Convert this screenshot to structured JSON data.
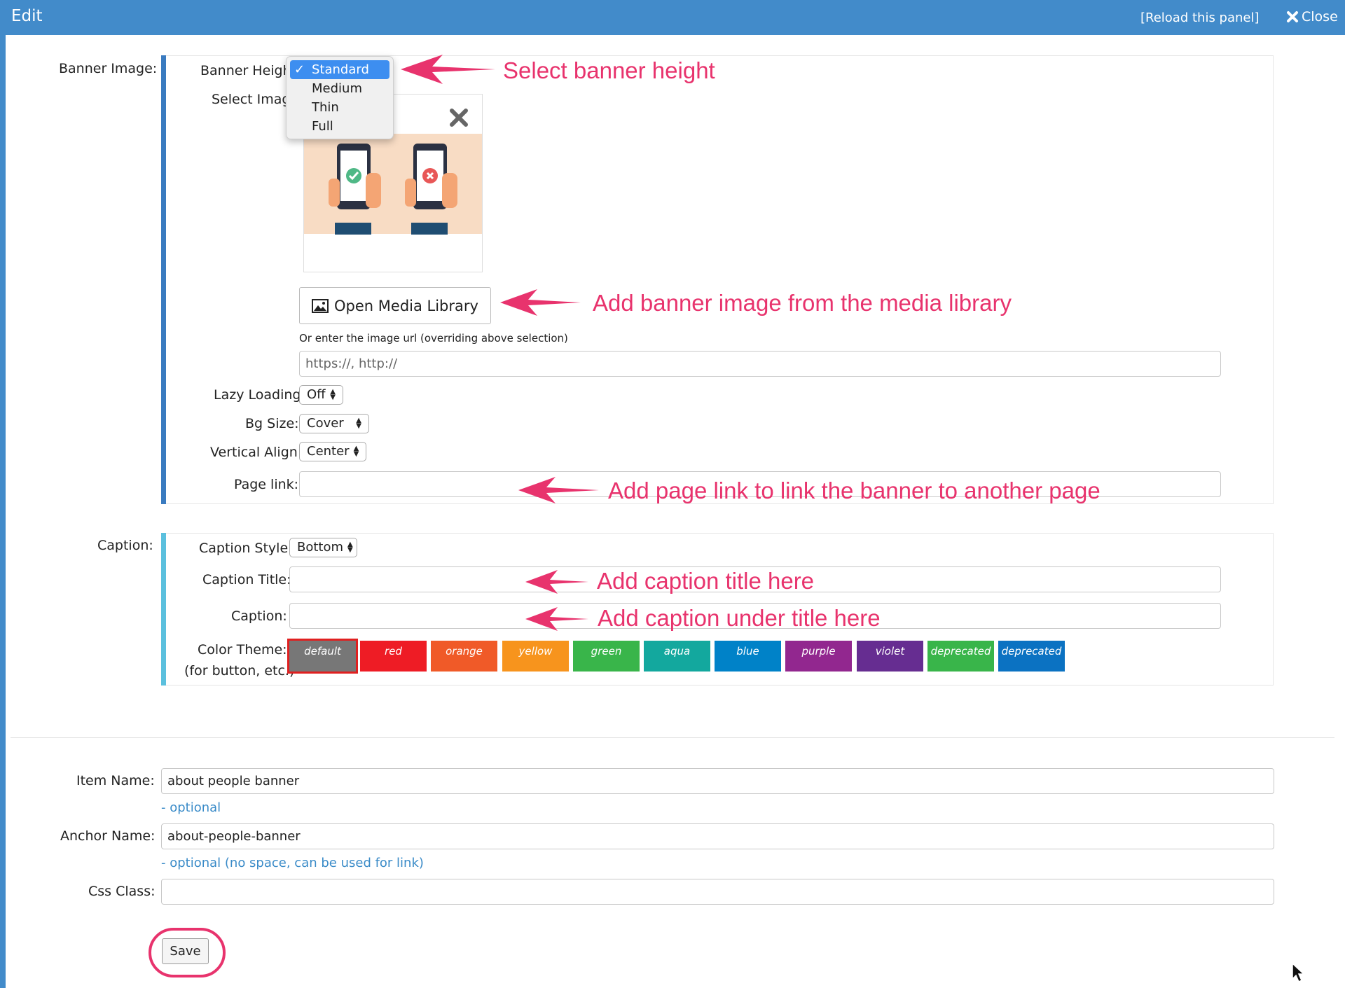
{
  "window": {
    "title": "Edit",
    "reload_label": "[Reload this panel]",
    "close_label": "Close"
  },
  "banner": {
    "section_label": "Banner Image:",
    "height_label": "Banner Height",
    "height_options": [
      "Standard",
      "Medium",
      "Thin",
      "Full"
    ],
    "height_selected": "Standard",
    "select_image_label": "Select Image",
    "open_media_label": "Open Media Library",
    "url_hint": "Or enter the image url (overriding above selection)",
    "url_placeholder": "https://, http://",
    "lazy_label": "Lazy Loading",
    "lazy_value": "Off",
    "bgsize_label": "Bg Size:",
    "bgsize_value": "Cover",
    "valign_label": "Vertical Align:",
    "valign_value": "Center",
    "pagelink_label": "Page link:",
    "pagelink_value": ""
  },
  "caption": {
    "section_label": "Caption:",
    "style_label": "Caption Style:",
    "style_value": "Bottom",
    "title_label": "Caption Title:",
    "title_value": "",
    "caption_label": "Caption:",
    "caption_value": "",
    "theme_label": "Color Theme:",
    "theme_sublabel": "(for button, etc.)",
    "themes": [
      {
        "name": "default",
        "color": "#777777",
        "selected": true
      },
      {
        "name": "red",
        "color": "#ee1c25"
      },
      {
        "name": "orange",
        "color": "#f05a28"
      },
      {
        "name": "yellow",
        "color": "#f7941d"
      },
      {
        "name": "green",
        "color": "#39b54a"
      },
      {
        "name": "aqua",
        "color": "#13a89e"
      },
      {
        "name": "blue",
        "color": "#0082c8"
      },
      {
        "name": "purple",
        "color": "#92278f"
      },
      {
        "name": "violet",
        "color": "#662d91"
      },
      {
        "name": "deprecated",
        "color": "#39b54a"
      },
      {
        "name": "deprecated",
        "color": "#0b72c2"
      }
    ]
  },
  "item": {
    "name_label": "Item Name:",
    "name_value": "about people banner",
    "name_hint": "- optional",
    "anchor_label": "Anchor Name:",
    "anchor_value": "about-people-banner",
    "anchor_hint": "- optional (no space, can be used for link)",
    "css_label": "Css Class:",
    "css_value": "",
    "save_label": "Save"
  },
  "annotations": {
    "height": "Select banner height",
    "media": "Add banner image from the media library",
    "pagelink": "Add page link to link the banner to another page",
    "caption_title": "Add caption title here",
    "caption": "Add caption under title here"
  },
  "colors": {
    "titlebar": "#428bca",
    "annotation": "#e8336d",
    "hint_link": "#3a8bc8"
  }
}
